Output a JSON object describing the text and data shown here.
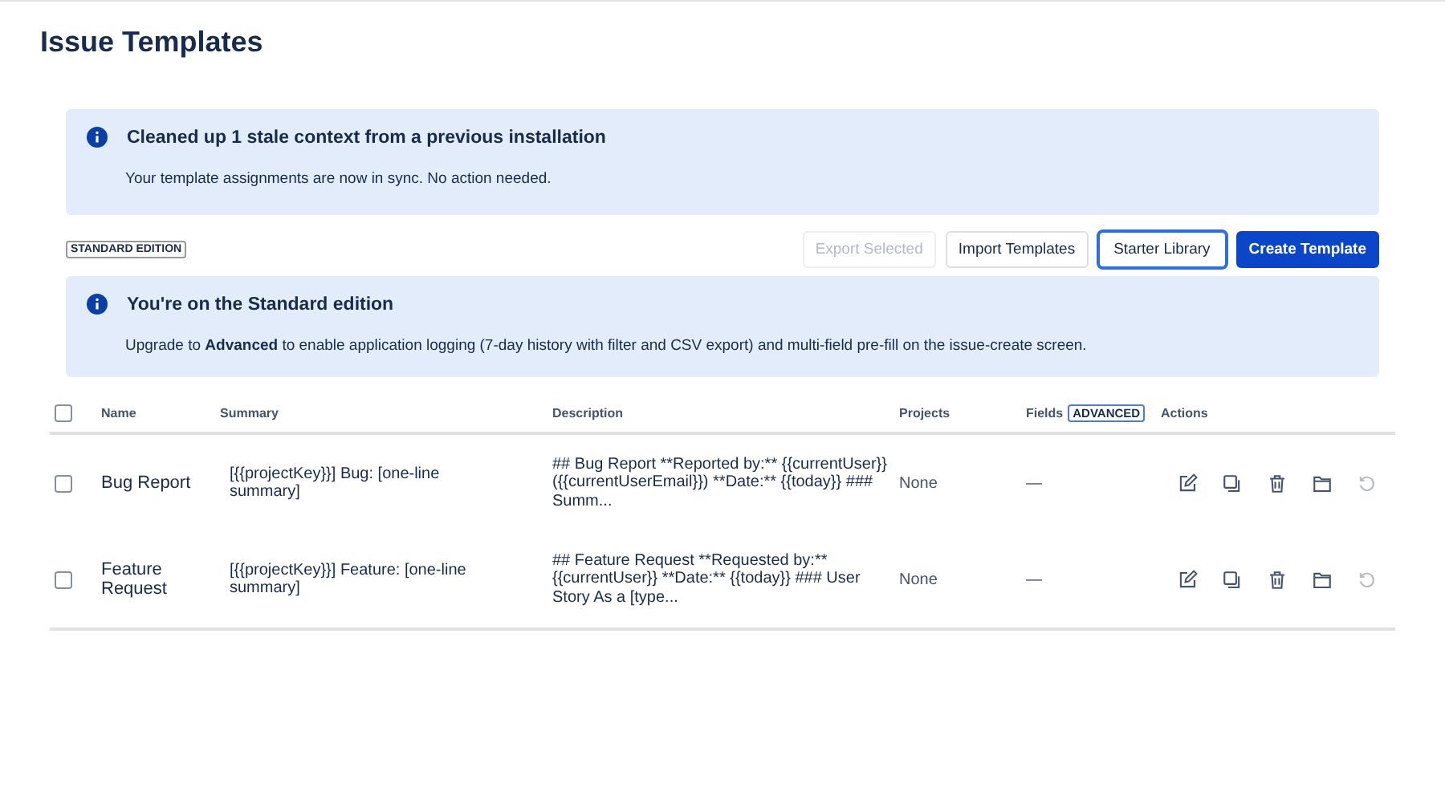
{
  "page": {
    "title": "Issue Templates"
  },
  "notices": [
    {
      "title": "Cleaned up 1 stale context from a previous installation",
      "body": "Your template assignments are now in sync. No action needed."
    }
  ],
  "edition_badge": "STANDARD EDITION",
  "buttons": [
    {
      "label": "Export Selected",
      "kind": "default",
      "disabled": true,
      "focused": false
    },
    {
      "label": "Import Templates",
      "kind": "default",
      "disabled": false,
      "focused": false
    },
    {
      "label": "Starter Library",
      "kind": "default",
      "disabled": false,
      "focused": true
    },
    {
      "label": "Create Template",
      "kind": "primary",
      "disabled": false,
      "focused": false
    }
  ],
  "edition_notice": {
    "title": "You're on the Standard edition",
    "body": "Upgrade to **Advanced** to enable application logging (7-day history with filter and CSV export) and multi-field pre-fill on the issue-create screen."
  },
  "table": {
    "select_all": {
      "checked": false
    },
    "columns": [
      {
        "label": "Name"
      },
      {
        "label": "Summary"
      },
      {
        "label": "Description"
      },
      {
        "label": "Projects"
      },
      {
        "label": "Fields",
        "badge": "ADVANCED"
      },
      {
        "label": "Actions"
      }
    ],
    "rows": [
      {
        "checked": false,
        "name": "Bug Report",
        "summary": "[{{projectKey}}] Bug: [one-line summary]",
        "description": "## Bug Report **Reported by:** {{currentUser}} ({{currentUserEmail}}) **Date:** {{today}} ### Summ...",
        "projects": "None",
        "fields": "—",
        "actions": [
          {
            "kind": "edit",
            "disabled": false
          },
          {
            "kind": "copy",
            "disabled": false
          },
          {
            "kind": "delete",
            "disabled": false
          },
          {
            "kind": "folder",
            "disabled": false
          },
          {
            "kind": "restore",
            "disabled": true
          }
        ]
      },
      {
        "checked": false,
        "name": "Feature Request",
        "summary": "[{{projectKey}}] Feature: [one-line summary]",
        "description": "## Feature Request **Requested by:** {{currentUser}} **Date:** {{today}} ### User Story As a [type...",
        "projects": "None",
        "fields": "—",
        "actions": [
          {
            "kind": "edit",
            "disabled": false
          },
          {
            "kind": "copy",
            "disabled": false
          },
          {
            "kind": "delete",
            "disabled": false
          },
          {
            "kind": "folder",
            "disabled": false
          },
          {
            "kind": "restore",
            "disabled": true
          }
        ]
      }
    ]
  }
}
